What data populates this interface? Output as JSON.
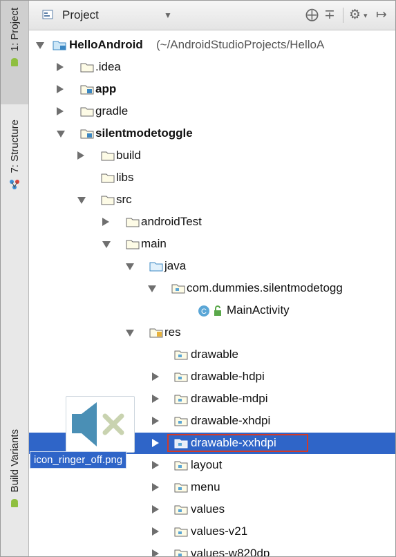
{
  "sidebar": {
    "tab_project": "1: Project",
    "tab_structure": "7: Structure",
    "tab_build_variants": "Build Variants"
  },
  "header": {
    "title": "Project",
    "dropdown_icon": "chevron-down-icon",
    "icons": [
      "target-icon",
      "collapse-icon",
      "gear-icon",
      "hide-icon"
    ]
  },
  "tree": {
    "root": {
      "label": "HelloAndroid",
      "path": "(~/AndroidStudioProjects/HelloA"
    },
    "idea": ".idea",
    "app": "app",
    "gradle": "gradle",
    "module": "silentmodetoggle",
    "build": "build",
    "libs": "libs",
    "src": "src",
    "androidTest": "androidTest",
    "main": "main",
    "java": "java",
    "package": "com.dummies.silentmodetogg",
    "mainActivity": "MainActivity",
    "res": "res",
    "drawable": "drawable",
    "drawable_hdpi": "drawable-hdpi",
    "drawable_mdpi": "drawable-mdpi",
    "drawable_xhdpi": "drawable-xhdpi",
    "drawable_xxhdpi": "drawable-xxhdpi",
    "layout": "layout",
    "menu": "menu",
    "values": "values",
    "values_v21": "values-v21",
    "values_w820dp": "values-w820dp"
  },
  "drag_preview": {
    "file_name": "icon_ringer_off.png",
    "icon": "speaker-muted-icon"
  },
  "colors": {
    "selection": "#2f65c8",
    "highlight_border": "#d23b2a",
    "folder": "#5aa6d6"
  }
}
